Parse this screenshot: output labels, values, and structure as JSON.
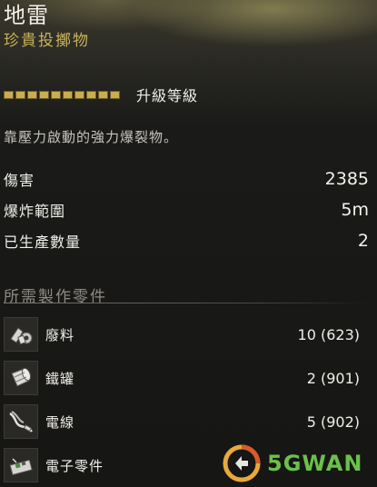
{
  "item": {
    "name": "地雷",
    "rarity": "珍貴投擲物",
    "upgrade_label": "升級等級",
    "upgrade_level": 10,
    "upgrade_max": 10,
    "description": "靠壓力啟動的強力爆裂物。"
  },
  "stats": [
    {
      "label": "傷害",
      "value": "2385"
    },
    {
      "label": "爆炸範圍",
      "value": "5m"
    },
    {
      "label": "已生產數量",
      "value": "2"
    }
  ],
  "components": {
    "title": "所需製作零件",
    "items": [
      {
        "name": "廢料",
        "qty": "10 (623)",
        "icon": "scrap-icon"
      },
      {
        "name": "鐵罐",
        "qty": "2 (901)",
        "icon": "tin-can-icon"
      },
      {
        "name": "電線",
        "qty": "5 (902)",
        "icon": "wire-icon"
      },
      {
        "name": "電子零件",
        "qty": "",
        "icon": "electronics-icon"
      }
    ]
  },
  "watermark": {
    "text": "5GWAN",
    "icon": "5gwan-logo-icon"
  },
  "colors": {
    "accent_gold": "#c9ad4e",
    "rarity": "#c9b15a",
    "text": "#f0eee8",
    "watermark": "#6cc04a"
  }
}
